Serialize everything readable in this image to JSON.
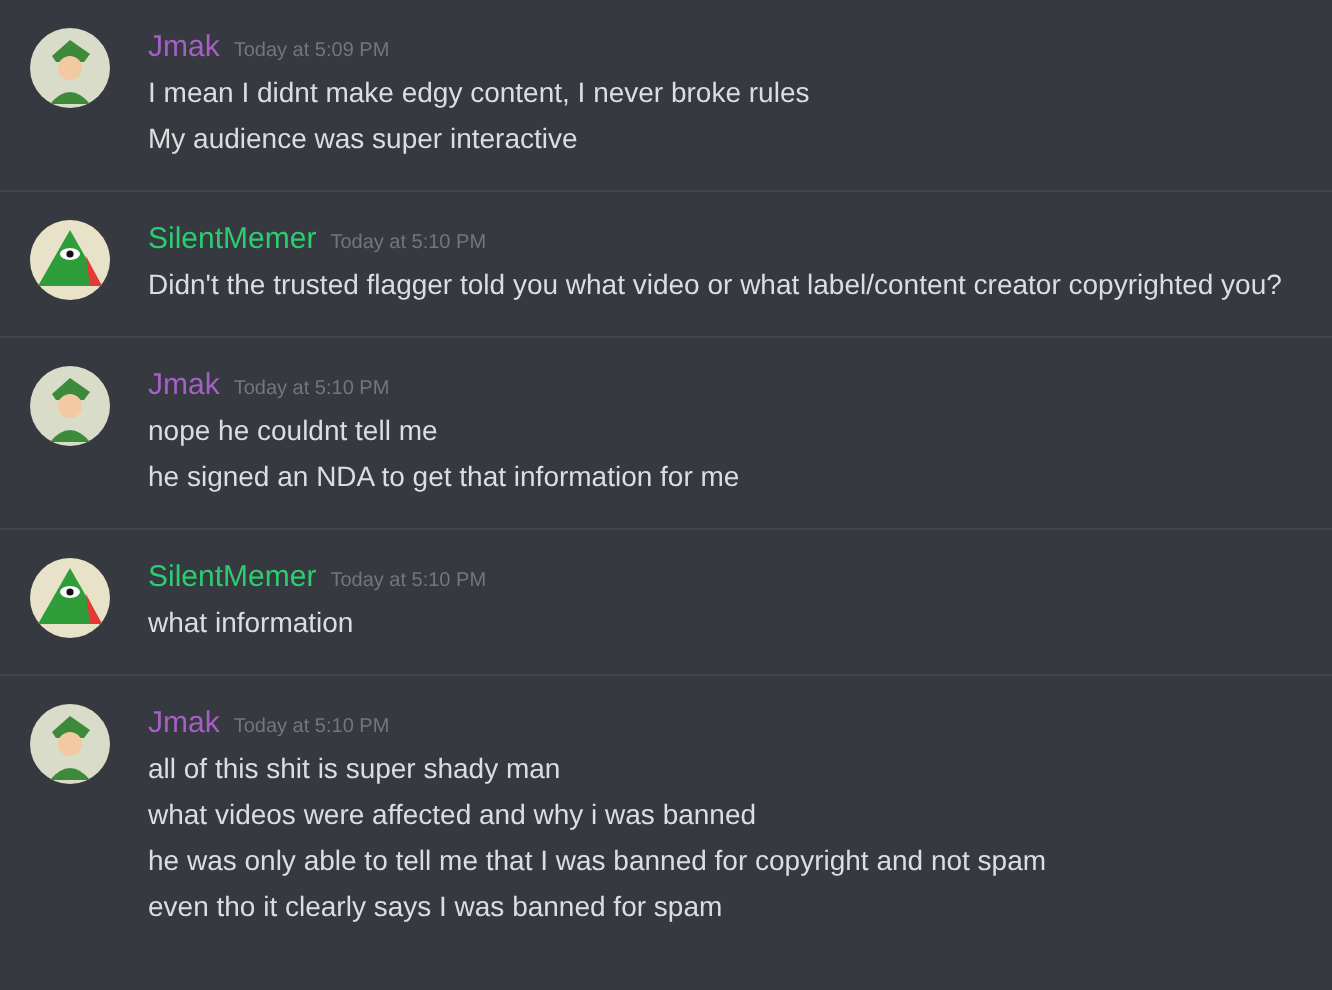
{
  "messages": [
    {
      "author": "Jmak",
      "color": "#a55fc6",
      "kind": "character",
      "time": "Today at 5:09 PM",
      "lines": [
        "I mean I didnt make edgy content, I never broke rules",
        "My audience was super interactive"
      ]
    },
    {
      "author": "SilentMemer",
      "color": "#2ecc71",
      "kind": "pyramid",
      "time": "Today at 5:10 PM",
      "lines": [
        "Didn't the trusted flagger told you what video or what label/content creator copyrighted you?"
      ]
    },
    {
      "author": "Jmak",
      "color": "#a55fc6",
      "kind": "character",
      "time": "Today at 5:10 PM",
      "lines": [
        "nope he couldnt tell me",
        "he signed an NDA to get that information for me"
      ]
    },
    {
      "author": "SilentMemer",
      "color": "#2ecc71",
      "kind": "pyramid",
      "time": "Today at 5:10 PM",
      "lines": [
        "what information"
      ]
    },
    {
      "author": "Jmak",
      "color": "#a55fc6",
      "kind": "character",
      "time": "Today at 5:10 PM",
      "lines": [
        "all of this shit is super shady man",
        "what videos were affected and why i was banned",
        "he was only able to tell me that I was banned for copyright and not spam",
        "even tho it clearly says I was banned for spam"
      ]
    }
  ]
}
